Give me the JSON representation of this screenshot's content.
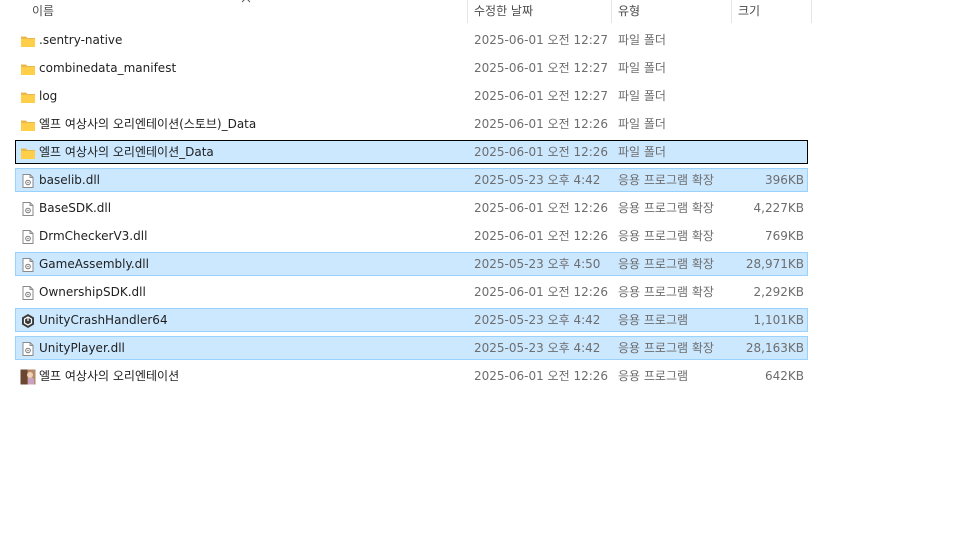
{
  "columns": {
    "name": "이름",
    "date": "수정한 날짜",
    "type": "유형",
    "size": "크기"
  },
  "files": [
    {
      "name": ".sentry-native",
      "date": "2025-06-01 오전 12:27",
      "type": "파일 폴더",
      "size": "",
      "icon": "folder-icon",
      "selected": false,
      "focused": false
    },
    {
      "name": "combinedata_manifest",
      "date": "2025-06-01 오전 12:27",
      "type": "파일 폴더",
      "size": "",
      "icon": "folder-icon",
      "selected": false,
      "focused": false
    },
    {
      "name": "log",
      "date": "2025-06-01 오전 12:27",
      "type": "파일 폴더",
      "size": "",
      "icon": "folder-icon",
      "selected": false,
      "focused": false
    },
    {
      "name": "엘프 여상사의 오리엔테이션(스토브)_Data",
      "date": "2025-06-01 오전 12:26",
      "type": "파일 폴더",
      "size": "",
      "icon": "folder-icon",
      "selected": false,
      "focused": false
    },
    {
      "name": "엘프 여상사의 오리엔테이션_Data",
      "date": "2025-06-01 오전 12:26",
      "type": "파일 폴더",
      "size": "",
      "icon": "folder-icon",
      "selected": true,
      "focused": true
    },
    {
      "name": "baselib.dll",
      "date": "2025-05-23 오후 4:42",
      "type": "응용 프로그램 확장",
      "size": "396KB",
      "icon": "dll-icon",
      "selected": true,
      "focused": false
    },
    {
      "name": "BaseSDK.dll",
      "date": "2025-06-01 오전 12:26",
      "type": "응용 프로그램 확장",
      "size": "4,227KB",
      "icon": "dll-icon",
      "selected": false,
      "focused": false
    },
    {
      "name": "DrmCheckerV3.dll",
      "date": "2025-06-01 오전 12:26",
      "type": "응용 프로그램 확장",
      "size": "769KB",
      "icon": "dll-icon",
      "selected": false,
      "focused": false
    },
    {
      "name": "GameAssembly.dll",
      "date": "2025-05-23 오후 4:50",
      "type": "응용 프로그램 확장",
      "size": "28,971KB",
      "icon": "dll-icon",
      "selected": true,
      "focused": false
    },
    {
      "name": "OwnershipSDK.dll",
      "date": "2025-06-01 오전 12:26",
      "type": "응용 프로그램 확장",
      "size": "2,292KB",
      "icon": "dll-icon",
      "selected": false,
      "focused": false
    },
    {
      "name": "UnityCrashHandler64",
      "date": "2025-05-23 오후 4:42",
      "type": "응용 프로그램",
      "size": "1,101KB",
      "icon": "unity-app-icon",
      "selected": true,
      "focused": false
    },
    {
      "name": "UnityPlayer.dll",
      "date": "2025-05-23 오후 4:42",
      "type": "응용 프로그램 확장",
      "size": "28,163KB",
      "icon": "dll-icon",
      "selected": true,
      "focused": false
    },
    {
      "name": "엘프 여상사의 오리엔테이션",
      "date": "2025-06-01 오전 12:26",
      "type": "응용 프로그램",
      "size": "642KB",
      "icon": "game-app-icon",
      "selected": false,
      "focused": false
    }
  ]
}
